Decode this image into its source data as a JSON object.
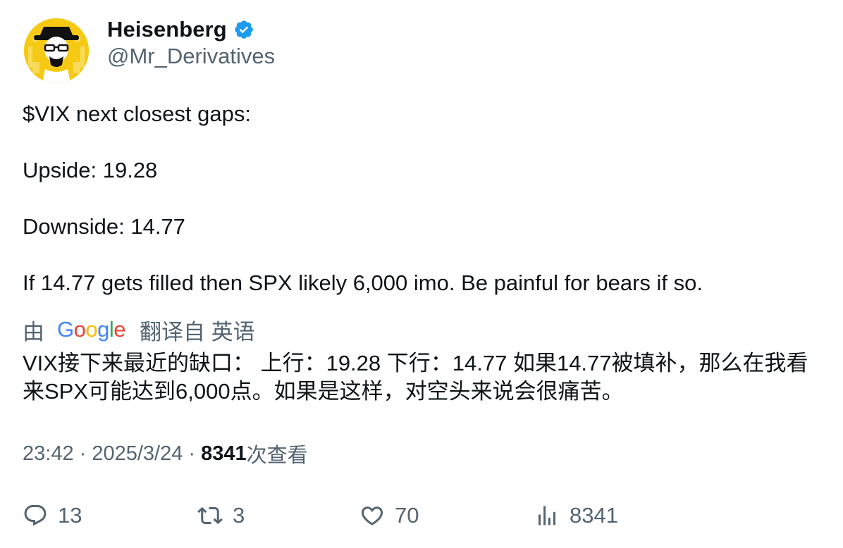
{
  "author": {
    "display_name": "Heisenberg",
    "handle": "@Mr_Derivatives",
    "verified": true,
    "avatar_icon": "heisenberg-avatar"
  },
  "tweet": {
    "lines": [
      "$VIX next closest gaps:",
      "",
      "Upside: 19.28",
      "",
      "Downside: 14.77",
      "",
      "If 14.77 gets filled then SPX likely 6,000 imo. Be painful for bears if so."
    ]
  },
  "translation": {
    "by_label": "由",
    "provider": "Google",
    "from_label": "翻译自 英语",
    "text": "VIX接下来最近的缺口： 上行：19.28 下行：14.77 如果14.77被填补，那么在我看来SPX可能达到6,000点。如果是这样，对空头来说会很痛苦。"
  },
  "meta": {
    "time": "23:42",
    "date": "2025/3/24",
    "views_count": "8341",
    "views_label": "次查看"
  },
  "actions": {
    "replies": "13",
    "reposts": "3",
    "likes": "70",
    "views": "8341"
  },
  "colors": {
    "text": "#0f1419",
    "secondary": "#536471",
    "verified": "#1d9bf0",
    "avatar_bg": "#f6c915"
  }
}
